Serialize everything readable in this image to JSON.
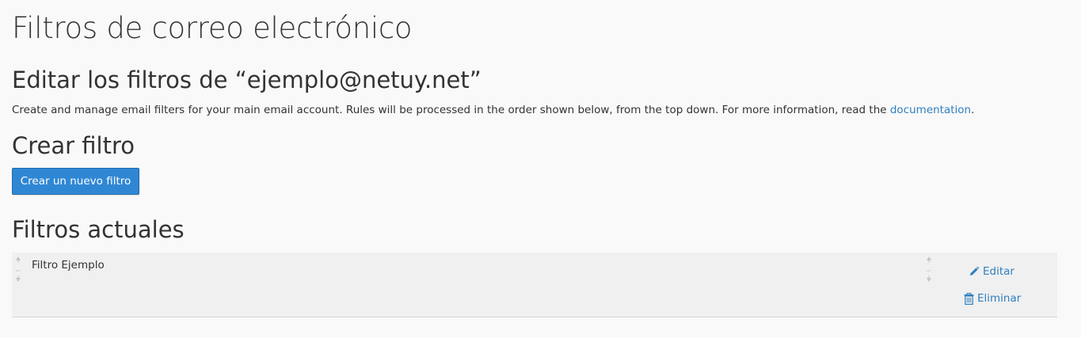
{
  "page": {
    "title": "Filtros de correo electrónico"
  },
  "edit_section": {
    "heading": "Editar los filtros de “ejemplo@netuy.net”",
    "description_prefix": "Create and manage email filters for your main email account. Rules will be processed in the order shown below, from the top down. For more information, read the ",
    "documentation_link": "documentation",
    "description_suffix": "."
  },
  "create_section": {
    "heading": "Crear filtro",
    "create_button_label": "Crear un nuevo filtro"
  },
  "current_section": {
    "heading": "Filtros actuales",
    "filters": [
      {
        "name": "Filtro Ejemplo",
        "edit_label": "Editar",
        "delete_label": "Eliminar"
      }
    ]
  },
  "colors": {
    "background": "#f9f9f9",
    "primary_button": "#2f87d4",
    "link": "#2f7fbf",
    "table_row": "#f0f0f0"
  },
  "icons": {
    "sort_handle": "sort-arrows-icon",
    "edit": "pencil-icon",
    "delete": "trash-icon"
  }
}
